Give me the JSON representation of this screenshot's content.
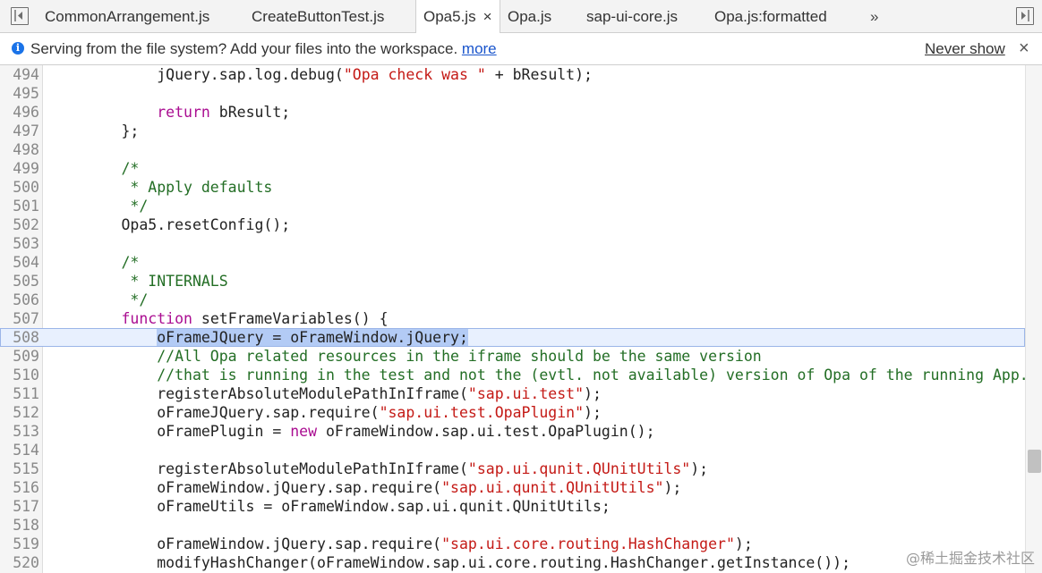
{
  "tabs": [
    {
      "label": "CommonArrangement.js",
      "active": false
    },
    {
      "label": "CreateButtonTest.js",
      "active": false
    },
    {
      "label": "Opa5.js",
      "active": true,
      "close": "×"
    },
    {
      "label": "Opa.js",
      "active": false
    },
    {
      "label": "sap-ui-core.js",
      "active": false
    },
    {
      "label": "Opa.js:formatted",
      "active": false
    }
  ],
  "tabs_overflow": "»",
  "infobar": {
    "message": "Serving from the file system? Add your files into the workspace.",
    "link": "more",
    "never_show": "Never show",
    "close": "×"
  },
  "editor": {
    "current_line": 508,
    "lines": [
      {
        "n": "494",
        "tokens": [
          [
            "",
            "            jQuery.sap.log.debug("
          ],
          [
            "str",
            "\"Opa check was \""
          ],
          [
            "",
            " + bResult);"
          ]
        ]
      },
      {
        "n": "495",
        "tokens": []
      },
      {
        "n": "496",
        "tokens": [
          [
            "",
            "            "
          ],
          [
            "kw",
            "return"
          ],
          [
            "",
            " bResult;"
          ]
        ]
      },
      {
        "n": "497",
        "tokens": [
          [
            "",
            "        };"
          ]
        ]
      },
      {
        "n": "498",
        "tokens": []
      },
      {
        "n": "499",
        "tokens": [
          [
            "com",
            "        /*"
          ]
        ]
      },
      {
        "n": "500",
        "tokens": [
          [
            "com",
            "         * Apply defaults"
          ]
        ]
      },
      {
        "n": "501",
        "tokens": [
          [
            "com",
            "         */"
          ]
        ]
      },
      {
        "n": "502",
        "tokens": [
          [
            "",
            "        Opa5.resetConfig();"
          ]
        ]
      },
      {
        "n": "503",
        "tokens": []
      },
      {
        "n": "504",
        "tokens": [
          [
            "com",
            "        /*"
          ]
        ]
      },
      {
        "n": "505",
        "tokens": [
          [
            "com",
            "         * INTERNALS"
          ]
        ]
      },
      {
        "n": "506",
        "tokens": [
          [
            "com",
            "         */"
          ]
        ]
      },
      {
        "n": "507",
        "tokens": [
          [
            "",
            "        "
          ],
          [
            "kw",
            "function"
          ],
          [
            "",
            " setFrameVariables() {"
          ]
        ]
      },
      {
        "n": "508",
        "tokens": [
          [
            "",
            "            "
          ],
          [
            "sel",
            "oFrameJQuery = oFrameWindow.jQuery;"
          ]
        ]
      },
      {
        "n": "509",
        "tokens": [
          [
            "com",
            "            //All Opa related resources in the iframe should be the same version"
          ]
        ]
      },
      {
        "n": "510",
        "tokens": [
          [
            "com",
            "            //that is running in the test and not the (evtl. not available) version of Opa of the running App."
          ]
        ]
      },
      {
        "n": "511",
        "tokens": [
          [
            "",
            "            registerAbsoluteModulePathInIframe("
          ],
          [
            "str",
            "\"sap.ui.test\""
          ],
          [
            "",
            ");"
          ]
        ]
      },
      {
        "n": "512",
        "tokens": [
          [
            "",
            "            oFrameJQuery.sap.require("
          ],
          [
            "str",
            "\"sap.ui.test.OpaPlugin\""
          ],
          [
            "",
            ");"
          ]
        ]
      },
      {
        "n": "513",
        "tokens": [
          [
            "",
            "            oFramePlugin = "
          ],
          [
            "kw",
            "new"
          ],
          [
            "",
            " oFrameWindow.sap.ui.test.OpaPlugin();"
          ]
        ]
      },
      {
        "n": "514",
        "tokens": []
      },
      {
        "n": "515",
        "tokens": [
          [
            "",
            "            registerAbsoluteModulePathInIframe("
          ],
          [
            "str",
            "\"sap.ui.qunit.QUnitUtils\""
          ],
          [
            "",
            ");"
          ]
        ]
      },
      {
        "n": "516",
        "tokens": [
          [
            "",
            "            oFrameWindow.jQuery.sap.require("
          ],
          [
            "str",
            "\"sap.ui.qunit.QUnitUtils\""
          ],
          [
            "",
            ");"
          ]
        ]
      },
      {
        "n": "517",
        "tokens": [
          [
            "",
            "            oFrameUtils = oFrameWindow.sap.ui.qunit.QUnitUtils;"
          ]
        ]
      },
      {
        "n": "518",
        "tokens": []
      },
      {
        "n": "519",
        "tokens": [
          [
            "",
            "            oFrameWindow.jQuery.sap.require("
          ],
          [
            "str",
            "\"sap.ui.core.routing.HashChanger\""
          ],
          [
            "",
            ");"
          ]
        ]
      },
      {
        "n": "520",
        "tokens": [
          [
            "",
            "            modifyHashChanger(oFrameWindow.sap.ui.core.routing.HashChanger.getInstance());"
          ]
        ]
      }
    ]
  },
  "watermark": "@稀土掘金技术社区",
  "colors": {
    "keyword": "#aa0d91",
    "string": "#c41a16",
    "comment": "#236e25",
    "selection": "#b3cbf5",
    "link": "#1a55cc"
  },
  "icons": {
    "left": "toggle-navigator-icon",
    "right": "toggle-debugger-icon",
    "info": "info-icon"
  }
}
